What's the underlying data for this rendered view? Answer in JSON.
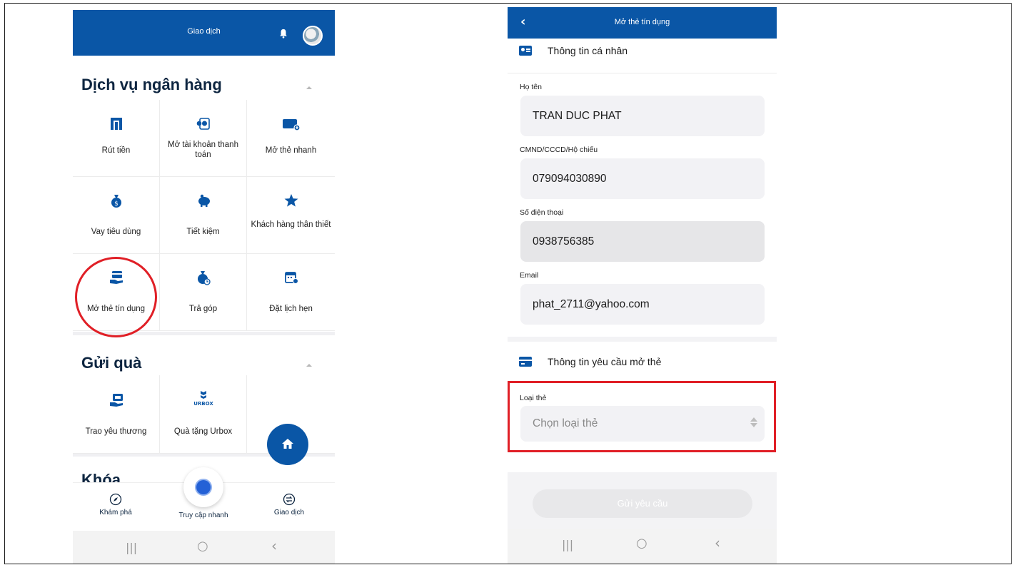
{
  "left": {
    "header_title": "Giao dịch",
    "banking_title": "Dịch vụ ngân hàng",
    "banking_items": [
      {
        "label": "Rút tiền",
        "icon": "atm-icon"
      },
      {
        "label": "Mở tài khoản thanh toán",
        "icon": "account-icon"
      },
      {
        "label": "Mở thẻ nhanh",
        "icon": "debit-card-icon"
      },
      {
        "label": "Vay tiêu dùng",
        "icon": "money-bag-icon"
      },
      {
        "label": "Tiết kiệm",
        "icon": "piggy-bank-icon"
      },
      {
        "label": "Khách hàng thân thiết",
        "icon": "star-icon"
      },
      {
        "label": "Mở thẻ tín dụng",
        "icon": "credit-card-hand-icon"
      },
      {
        "label": "Trả góp",
        "icon": "installment-bag-icon"
      },
      {
        "label": "Đặt lịch hẹn",
        "icon": "calendar-icon"
      }
    ],
    "gift_title": "Gửi quà",
    "gift_items": [
      {
        "label": "Trao yêu thương",
        "icon": "gift-card-hand-icon"
      },
      {
        "label": "Quà tặng Urbox",
        "icon": "urbox-logo-icon",
        "logo_text": "URBOX"
      }
    ],
    "khoa_title": "Khóa",
    "nav": {
      "explore": "Khám phá",
      "quick": "Truy cập nhanh",
      "transactions": "Giao dịch"
    },
    "android": {
      "recents": "|||",
      "home": "○",
      "back": "‹"
    }
  },
  "right": {
    "header_back": "‹",
    "header_title": "Mở thẻ tín dụng",
    "personal_title": "Thông tin cá nhân",
    "fields": {
      "name_label": "Họ tên",
      "name_value": "TRAN DUC PHAT",
      "id_label": "CMND/CCCD/Hộ chiếu",
      "id_value": "079094030890",
      "phone_label": "Số điện thoại",
      "phone_value": "0938756385",
      "email_label": "Email",
      "email_value": "phat_2711@yahoo.com"
    },
    "request_title": "Thông tin yêu cầu mở thẻ",
    "card_type_label": "Loại thẻ",
    "card_type_placeholder": "Chọn loại thẻ",
    "submit_label": "Gửi yêu cầu",
    "android": {
      "recents": "|||",
      "home": "○",
      "back": "‹"
    }
  },
  "colors": {
    "brand": "#0a56a6",
    "highlight": "#e01f26"
  }
}
